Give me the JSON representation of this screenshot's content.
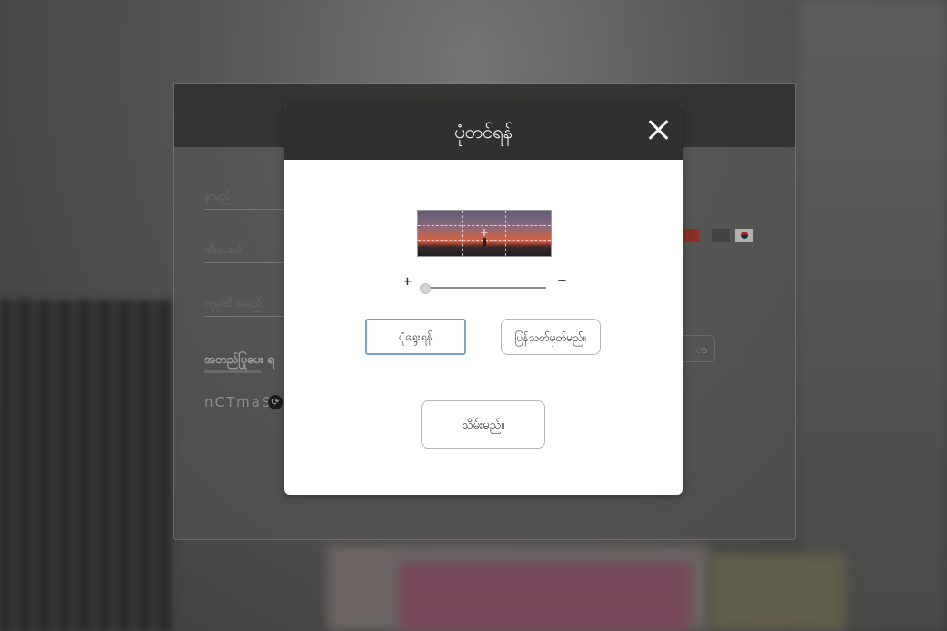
{
  "background_panel": {
    "fields": [
      {
        "placeholder": "နာမည်"
      },
      {
        "placeholder": "အီးမေးလ်"
      },
      {
        "placeholder": "ကုမ္ပဏီ အမည်"
      }
    ],
    "rules_label": "အတည်ပြုပေး ရ",
    "captcha_text": "nCTmaS",
    "side_button_label": "ာ"
  },
  "modal": {
    "title": "ပုံတင်ရန်",
    "zoom_in_label": "+",
    "zoom_out_label": "−",
    "zoom_level": 0,
    "choose_button": "ပုံရွေးရန်",
    "reset_button": "ပြန်သတ်မှတ်မည်။",
    "save_button": "သိမ်းမည်။"
  },
  "colors": {
    "modal_header": "#303030",
    "choose_border": "#7aa3d8"
  }
}
